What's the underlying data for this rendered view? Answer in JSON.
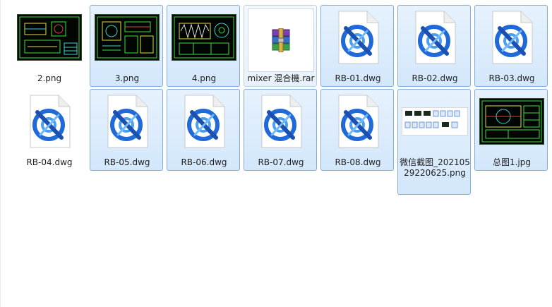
{
  "files": [
    {
      "name": "2.png",
      "icon": "cad-drawing-thumbnail",
      "state": "normal"
    },
    {
      "name": "3.png",
      "icon": "cad-drawing-thumbnail",
      "state": "selected"
    },
    {
      "name": "4.png",
      "icon": "cad-drawing-thumbnail",
      "state": "selected"
    },
    {
      "name": "mixer 混合機.rar",
      "icon": "winrar-archive-icon",
      "state": "hover"
    },
    {
      "name": "RB-01.dwg",
      "icon": "autocad-dwg-file-icon",
      "state": "selected"
    },
    {
      "name": "RB-02.dwg",
      "icon": "autocad-dwg-file-icon",
      "state": "selected"
    },
    {
      "name": "RB-03.dwg",
      "icon": "autocad-dwg-file-icon",
      "state": "selected"
    },
    {
      "name": "RB-04.dwg",
      "icon": "autocad-dwg-file-icon",
      "state": "normal"
    },
    {
      "name": "RB-05.dwg",
      "icon": "autocad-dwg-file-icon",
      "state": "selected"
    },
    {
      "name": "RB-06.dwg",
      "icon": "autocad-dwg-file-icon",
      "state": "selected"
    },
    {
      "name": "RB-07.dwg",
      "icon": "autocad-dwg-file-icon",
      "state": "selected"
    },
    {
      "name": "RB-08.dwg",
      "icon": "autocad-dwg-file-icon",
      "state": "selected"
    },
    {
      "name": "微信截图_20210529220625.png",
      "icon": "screenshot-thumbnail",
      "state": "selected"
    },
    {
      "name": "总图1.jpg",
      "icon": "cad-drawing-thumbnail",
      "state": "selected"
    }
  ],
  "colors": {
    "selection_fill": "#d3e7fb",
    "selection_border": "#84acdd",
    "cad_background": "#020602",
    "cad_lines": "#3fdc3f",
    "dwg_blue": "#1f6ad8"
  }
}
